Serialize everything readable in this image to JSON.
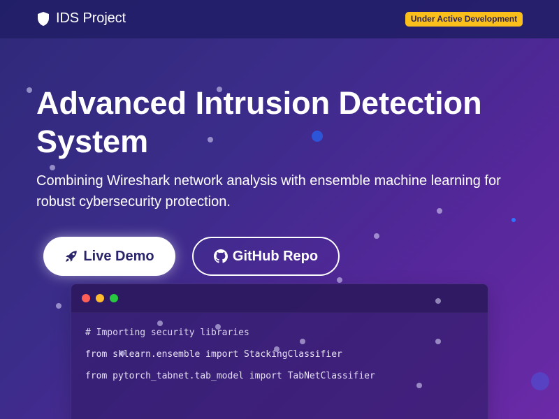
{
  "brand": {
    "name": "IDS Project",
    "icon": "shield-icon"
  },
  "badge": {
    "label": "Under Active Development",
    "color": "#fbbf1c"
  },
  "hero": {
    "title": "Advanced Intrusion Detection System",
    "subtitle": "Combining Wireshark network analysis with ensemble machine learning for robust cybersecurity protection."
  },
  "buttons": {
    "demo": {
      "label": "Live Demo",
      "icon": "rocket-icon"
    },
    "repo": {
      "label": "GitHub Repo",
      "icon": "github-icon"
    }
  },
  "code_window": {
    "lines": [
      "# Importing security libraries",
      "from sklearn.ensemble import StackingClassifier",
      "from pytorch_tabnet.tab_model import TabNetClassifier"
    ]
  },
  "colors": {
    "background_start": "#2f2a79",
    "background_end": "#6c2aa8",
    "accent_blue": "#2d55d8"
  }
}
